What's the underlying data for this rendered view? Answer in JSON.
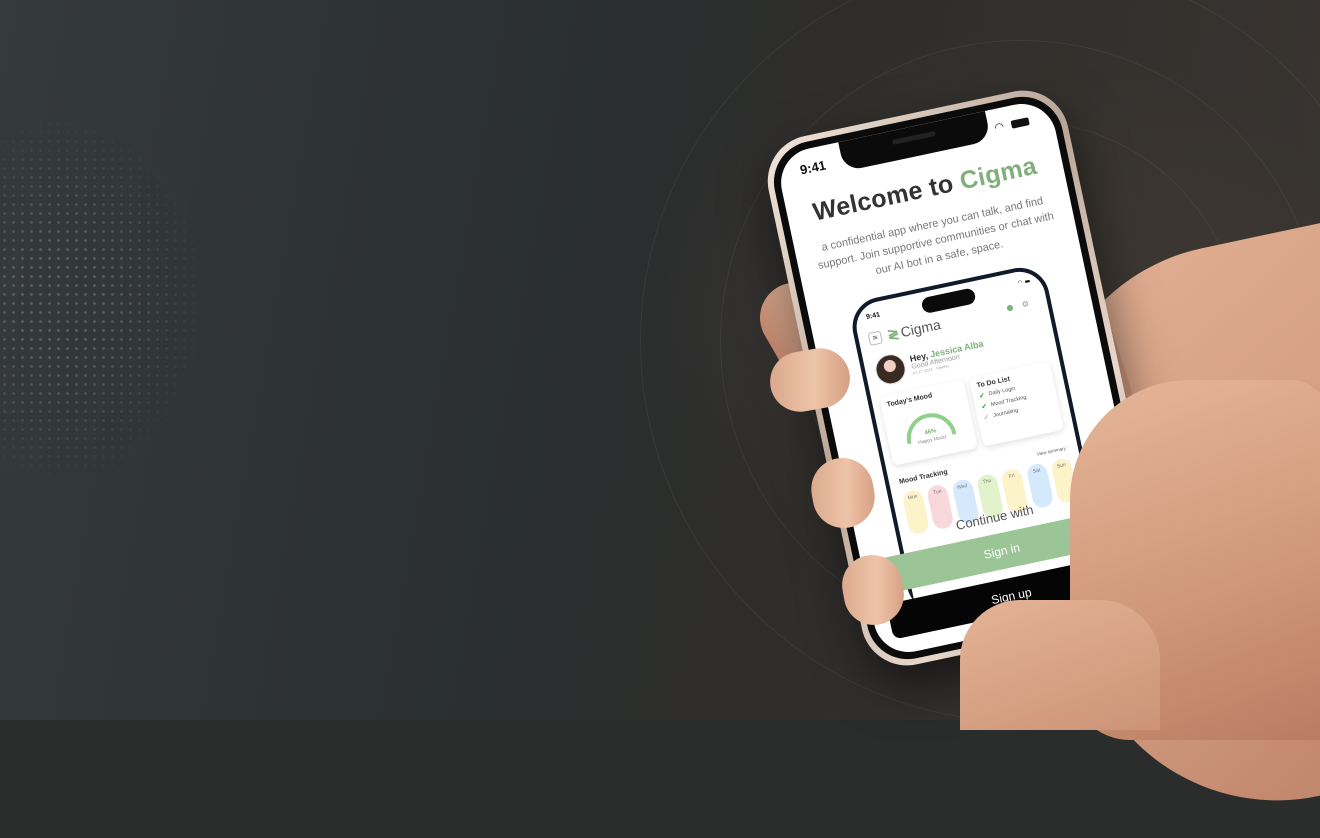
{
  "status": {
    "time": "9:41"
  },
  "welcome": {
    "prefix": "Welcome to ",
    "brand": "Cigma"
  },
  "tagline": "a confidential app where you can talk, and find support. Join supportive communities or chat with our AI bot in a safe, space.",
  "preview": {
    "time": "9:41",
    "logo": "Cigma",
    "greeting": {
      "hey": "Hey, ",
      "name": "Jessica Alba",
      "sub": "Good Afternoon",
      "date": "Fri 17 2024 · Weekly"
    },
    "mood": {
      "title": "Today's Mood",
      "value": "46%",
      "label": "Happy Mood"
    },
    "todo": {
      "title": "To Do List",
      "items": [
        {
          "label": "Daily Login",
          "done": true
        },
        {
          "label": "Mood Tracking",
          "done": true
        },
        {
          "label": "Journaling",
          "done": false
        }
      ]
    },
    "tracking": {
      "title": "Mood Tracking",
      "view": "View summary",
      "days": [
        "Mon",
        "Tue",
        "Wed",
        "Thu",
        "Fri",
        "Sat",
        "Sun"
      ],
      "colors": [
        "#fdf3c9",
        "#f9d8dc",
        "#d6e8fb",
        "#e2f3cc",
        "#fdf3c9",
        "#d6e8fb",
        "#fdf3c9"
      ]
    }
  },
  "continue_label": "Continue with",
  "signin_label": "Sign in",
  "signup_label": "Sign up",
  "colors": {
    "brand": "#7fb07b",
    "signin": "#9bc596",
    "signup": "#050505"
  }
}
